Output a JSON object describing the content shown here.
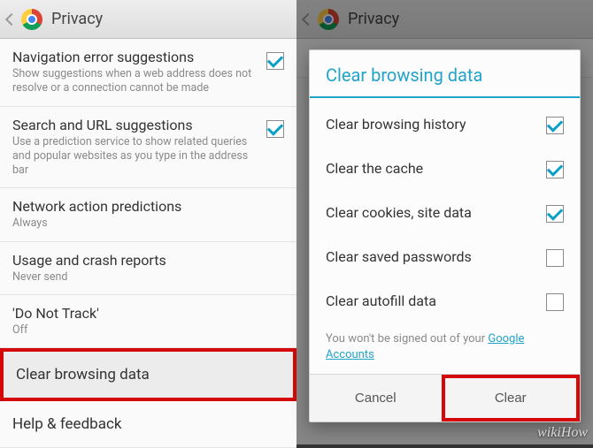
{
  "header": {
    "title": "Privacy"
  },
  "left": {
    "items": [
      {
        "title": "Navigation error suggestions",
        "sub": "Show suggestions when a web address does not resolve or a connection cannot be made",
        "checked": true
      },
      {
        "title": "Search and URL suggestions",
        "sub": "Use a prediction service to show related queries and popular websites as you type in the address bar",
        "checked": true
      },
      {
        "title": "Network action predictions",
        "sub": "Always"
      },
      {
        "title": "Usage and crash reports",
        "sub": "Never send"
      },
      {
        "title": "'Do Not Track'",
        "sub": "Off"
      }
    ],
    "clear": "Clear browsing data",
    "help": "Help & feedback"
  },
  "dialog": {
    "title": "Clear browsing data",
    "options": [
      {
        "label": "Clear browsing history",
        "checked": true
      },
      {
        "label": "Clear the cache",
        "checked": true
      },
      {
        "label": "Clear cookies, site data",
        "checked": true
      },
      {
        "label": "Clear saved passwords",
        "checked": false
      },
      {
        "label": "Clear autofill data",
        "checked": false
      }
    ],
    "note_prefix": "You won't be signed out of your ",
    "note_link": "Google Accounts",
    "cancel": "Cancel",
    "clear": "Clear"
  },
  "watermark": "wikiHow"
}
